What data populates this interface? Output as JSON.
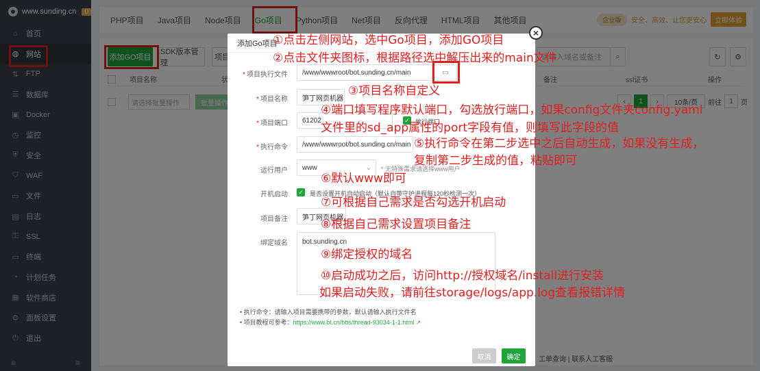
{
  "app": {
    "site": "www.sunding.cn",
    "badge_count": "0"
  },
  "sidebar": {
    "items": [
      {
        "label": "首页",
        "icon": "home-icon"
      },
      {
        "label": "网站",
        "icon": "globe-icon"
      },
      {
        "label": "FTP",
        "icon": "ftp-icon"
      },
      {
        "label": "数据库",
        "icon": "database-icon"
      },
      {
        "label": "Docker",
        "icon": "docker-icon"
      },
      {
        "label": "监控",
        "icon": "monitor-icon"
      },
      {
        "label": "安全",
        "icon": "shield-icon"
      },
      {
        "label": "WAF",
        "icon": "waf-icon"
      },
      {
        "label": "文件",
        "icon": "folder-icon"
      },
      {
        "label": "日志",
        "icon": "log-icon"
      },
      {
        "label": "SSL",
        "icon": "ssl-icon"
      },
      {
        "label": "终端",
        "icon": "terminal-icon"
      },
      {
        "label": "计划任务",
        "icon": "clock-icon"
      },
      {
        "label": "软件商店",
        "icon": "store-icon"
      },
      {
        "label": "面板设置",
        "icon": "gear-icon"
      },
      {
        "label": "退出",
        "icon": "logout-icon"
      }
    ],
    "active_index": 1
  },
  "tabs": [
    "PHP项目",
    "Java项目",
    "Node项目",
    "Go项目",
    "Python项目",
    "Net项目",
    "反向代理",
    "HTML项目",
    "其他项目"
  ],
  "active_tab": 3,
  "vip": {
    "badge": "企业版",
    "text": "安全、高效、让您更安心",
    "button": "立即体验"
  },
  "toolbar": {
    "add_go": "添加GO项目",
    "sdk": "SDK版本管理",
    "proj": "项目",
    "search_placeholder": "请输入域名或备注"
  },
  "table": {
    "headers": [
      "项目名称",
      "状",
      "备注",
      "ssl证书",
      "操作"
    ],
    "batch_placeholder": "请选择批量操作",
    "batch_btn": "批量操作",
    "page": "1",
    "per_page": "10条/页",
    "goto_page": "1",
    "page_unit": "页"
  },
  "footer": {
    "links": "工单查询 | 联系人工客服"
  },
  "modal": {
    "title": "添加Go项目",
    "fields": {
      "exec_label": "项目执行文件",
      "exec_value": "/www/wwwroot/bot.sunding.cn/main",
      "name_label": "项目名称",
      "name_value": "笋丁网页机器人",
      "port_label": "项目端口",
      "port_value": "61202",
      "open_port": "放行端口",
      "cmd_label": "执行命令",
      "cmd_value": "/www/wwwroot/bot.sunding.cn/main",
      "user_label": "运行用户",
      "user_value": "www",
      "user_hint": "* 无特殊需求请选择www用户",
      "boot_label": "开机启动",
      "boot_text": "是否设置开机自动启动（默认自带守护进程每120秒检测一次）",
      "remark_label": "项目备注",
      "remark_value": "笋丁网页机器人",
      "domain_label": "绑定域名",
      "domain_value": "bot.sunding.cn"
    },
    "tips": {
      "tip1": "执行命令：请输入项目需要携带的参数，默认请输入执行文件名",
      "tip2_prefix": "项目教程可参考：",
      "tip2_link": "https://www.bt.cn/bbs/thread-93034-1-1.html"
    },
    "cancel": "取消",
    "confirm": "确定"
  },
  "annotations": [
    "①点击左侧网站，选中Go项目，添加GO项目",
    "②点击文件夹图标，根据路径选中解压出来的main文件",
    "③项目名称自定义",
    "④端口填写程序默认端口，勾选放行端口，如果config文件夹config.yaml",
    "文件里的sd_app属性的port字段有值，则填写此字段的值",
    "⑤执行命令在第二步选中之后自动生成，如果没有生成，",
    "复制第二步生成的值，粘贴即可",
    "⑥默认www即可",
    "⑦可根据自己需求是否勾选开机启动",
    "⑧根据自己需求设置项目备注",
    "⑨绑定授权的域名",
    "⑩启动成功之后，访问http://授权域名/install进行安装",
    "如果启动失败，请前往storage/logs/app.log查看报错详情"
  ],
  "colors": {
    "accent": "#20a53a",
    "annotation": "#e02020",
    "sidebar": "#3c444d"
  }
}
